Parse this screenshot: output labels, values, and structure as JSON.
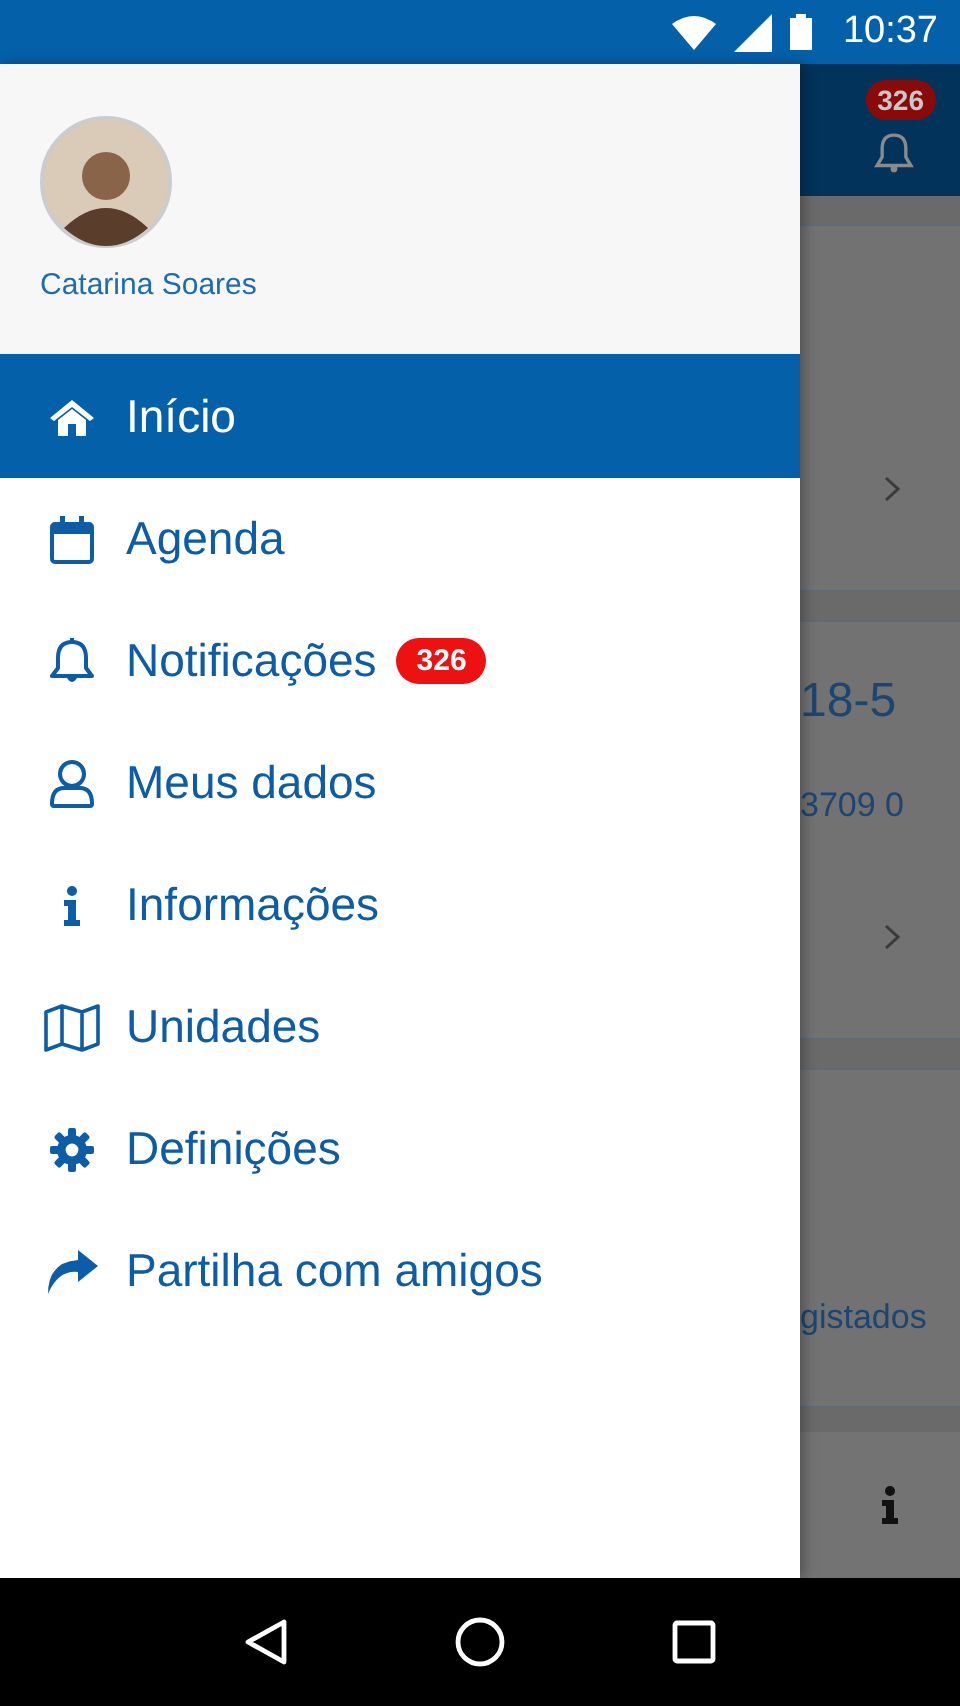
{
  "status_bar": {
    "time": "10:37"
  },
  "drawer": {
    "user": {
      "name": "Catarina Soares"
    },
    "items": [
      {
        "label": "Início",
        "selected": true
      },
      {
        "label": "Agenda",
        "selected": false
      },
      {
        "label": "Notificações",
        "selected": false,
        "badge": "326"
      },
      {
        "label": "Meus dados",
        "selected": false
      },
      {
        "label": "Informações",
        "selected": false
      },
      {
        "label": "Unidades",
        "selected": false
      },
      {
        "label": "Definições",
        "selected": false
      },
      {
        "label": "Partilha com amigos",
        "selected": false
      }
    ]
  },
  "background": {
    "notification_badge": "326",
    "cards": [
      {
        "kind": "link"
      },
      {
        "kind": "link",
        "title": "18-5",
        "text": "3709 0"
      },
      {
        "kind": "plain",
        "text": "gistados"
      }
    ]
  }
}
